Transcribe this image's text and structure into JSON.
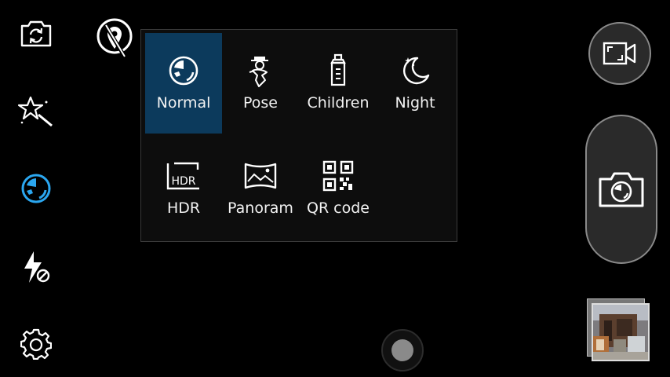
{
  "left_rail": {
    "switch_camera_icon": "camera-switch-icon",
    "effects_icon": "magic-wand-icon",
    "scene_icon": "scene-mode-icon",
    "flash_icon": "flash-off-icon",
    "settings_icon": "gear-icon"
  },
  "location_toggle": {
    "icon": "location-off-icon"
  },
  "scene_modes": [
    {
      "label": "Normal",
      "icon": "normal-scene-icon",
      "selected": true
    },
    {
      "label": "Pose",
      "icon": "pose-icon",
      "selected": false
    },
    {
      "label": "Children",
      "icon": "bottle-icon",
      "selected": false
    },
    {
      "label": "Night",
      "icon": "moon-icon",
      "selected": false
    },
    {
      "label": "HDR",
      "icon": "hdr-icon",
      "selected": false
    },
    {
      "label": "Panoram",
      "icon": "panorama-icon",
      "selected": false
    },
    {
      "label": "QR code",
      "icon": "qr-code-icon",
      "selected": false
    }
  ],
  "right_controls": {
    "video_icon": "video-camera-icon",
    "shutter_icon": "camera-shutter-icon",
    "gallery_icon": "gallery-thumbnail"
  },
  "colors": {
    "accent": "#2ba7f0",
    "selected_bg": "#0c3a5c",
    "panel_bg": "#0d0d0d"
  }
}
